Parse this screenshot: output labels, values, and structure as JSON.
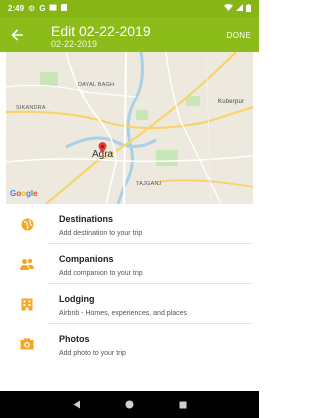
{
  "status_bar": {
    "time": "2:49",
    "left_icons": [
      "gear-icon",
      "google-g-icon",
      "message-icon",
      "sd-card-icon"
    ],
    "right_icons": [
      "wifi-icon",
      "signal-icon",
      "battery-icon"
    ]
  },
  "app_bar": {
    "title": "Edit 02-22-2019",
    "subtitle": "02-22-2019",
    "done_label": "DONE",
    "background": "#8cbc1a"
  },
  "map": {
    "labels": {
      "dayal_bagh": "DAYAL BAGH",
      "sikandra": "SIKANDRA",
      "kuberpur": "Kuberpur",
      "tajganj": "TAJGANJ",
      "city": "Agra"
    },
    "google": {
      "g1": "G",
      "o1": "o",
      "o2": "o",
      "g2": "g",
      "l": "l",
      "e": "e"
    }
  },
  "sections": [
    {
      "icon": "destinations-icon",
      "title": "Destinations",
      "subtitle": "Add destination to your trip"
    },
    {
      "icon": "companions-icon",
      "title": "Companions",
      "subtitle": "Add companion to your trip"
    },
    {
      "icon": "lodging-icon",
      "title": "Lodging",
      "subtitle": "Airbnb - Homes, experiences, and places"
    },
    {
      "icon": "photos-icon",
      "title": "Photos",
      "subtitle": "Add photo to your trip"
    }
  ],
  "nav_bar": {
    "buttons": [
      "back-nav",
      "home-nav",
      "recents-nav"
    ]
  },
  "colors": {
    "accent": "#8cbc1a",
    "icon_orange": "#f5a623",
    "status_bar": "#86b515"
  }
}
